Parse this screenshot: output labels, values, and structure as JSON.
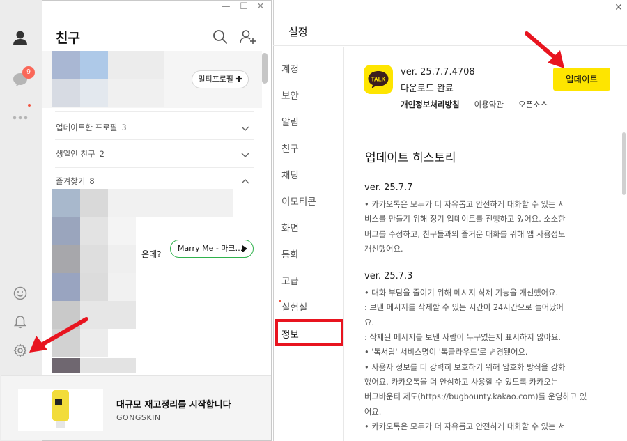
{
  "left_window": {
    "controls": {
      "minimize": "—",
      "maximize": "☐",
      "close": "✕"
    },
    "rail": {
      "chat_badge": "9"
    },
    "title": "친구",
    "profile_banner": {
      "multi_profile_label": "멀티프로필 ✚"
    },
    "sections": [
      {
        "label": "업데이트한 프로필",
        "count": "3"
      },
      {
        "label": "생일인 친구",
        "count": "2"
      },
      {
        "label": "즐겨찾기",
        "count": "8"
      }
    ],
    "favorites": {
      "partial_status": "은데?",
      "music_label": "Marry Me - 마크…"
    },
    "ad": {
      "title": "대규모 재고정리를 시작합니다",
      "brand": "GONGSKIN"
    }
  },
  "right_window": {
    "title": "설정",
    "close": "✕",
    "nav": [
      "계정",
      "보안",
      "알림",
      "친구",
      "채팅",
      "이모티콘",
      "화면",
      "통화",
      "고급",
      "실험실",
      "정보"
    ],
    "app_logo_text": "TALK",
    "version": "ver. 25.7.7.4708",
    "download_status": "다운로드 완료",
    "links": [
      "개인정보처리방침",
      "이용약관",
      "오픈소스"
    ],
    "update_button": "업데이트",
    "history_title": "업데이트 히스토리",
    "history": [
      {
        "version": "ver. 25.7.7",
        "lines": [
          "• 카카오톡은 모두가 더 자유롭고 안전하게 대화할 수 있는 서",
          "비스를 만들기 위해 정기 업데이트를 진행하고 있어요. 소소한",
          "버그를 수정하고, 친구들과의 즐거운 대화를 위해 앱 사용성도",
          "개선했어요."
        ]
      },
      {
        "version": "ver. 25.7.3",
        "lines": [
          "• 대화 부담을 줄이기 위해 메시지 삭제 기능을 개선했어요.",
          ": 보낸 메시지를 삭제할 수 있는 시간이 24시간으로 늘어났어",
          "요.",
          ": 삭제된 메시지를 보낸 사람이 누구였는지 표시하지 않아요.",
          "• '톡서랍' 서비스명이 '톡클라우드'로 변경됐어요.",
          "• 사용자 정보를 더 강력히 보호하기 위해 암호화 방식을 강화",
          "했어요. 카카오톡을 더 안심하고 사용할 수 있도록 카카오는",
          "버그바운티 제도(https://bugbounty.kakao.com)를 운영하고 있",
          "어요.",
          "• 카카오톡은 모두가 더 자유롭고 안전하게 대화할 수 있는 서"
        ]
      }
    ]
  },
  "colors": {
    "kakao_yellow": "#fee500",
    "highlight_red": "#e8141f",
    "badge_red": "#fa6758",
    "music_green": "#2fb24c"
  },
  "icons": [
    "person-icon",
    "chat-bubble-icon",
    "more-dots-icon",
    "emoji-icon",
    "bell-icon",
    "gear-icon",
    "search-icon",
    "add-friend-icon",
    "chevron-down-icon",
    "chevron-up-icon",
    "play-icon",
    "close-icon"
  ]
}
